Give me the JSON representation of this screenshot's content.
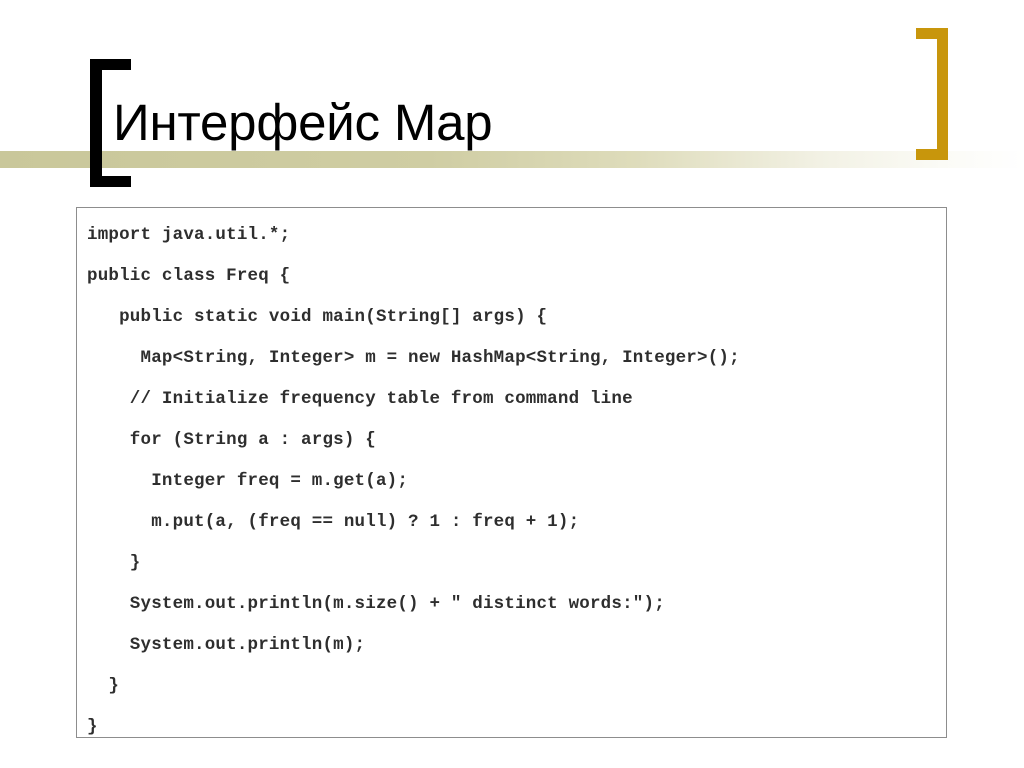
{
  "slide": {
    "title": "Интерфейс Map",
    "background_color": "#ffffff",
    "accent_bar_color": "#c9c79a",
    "left_bracket_color": "#000000",
    "right_bracket_color": "#c8960c",
    "code_border_color": "#8d8d8d",
    "code_text_color": "#2e2e2e"
  },
  "code": {
    "language": "java",
    "lines": [
      "import java.util.*;",
      "public class Freq {",
      "   public static void main(String[] args) {",
      "     Map<String, Integer> m = new HashMap<String, Integer>();",
      "    // Initialize frequency table from command line",
      "    for (String a : args) {",
      "      Integer freq = m.get(a);",
      "      m.put(a, (freq == null) ? 1 : freq + 1);",
      "    }",
      "    System.out.println(m.size() + \" distinct words:\");",
      "    System.out.println(m);",
      "  }",
      "}"
    ]
  }
}
